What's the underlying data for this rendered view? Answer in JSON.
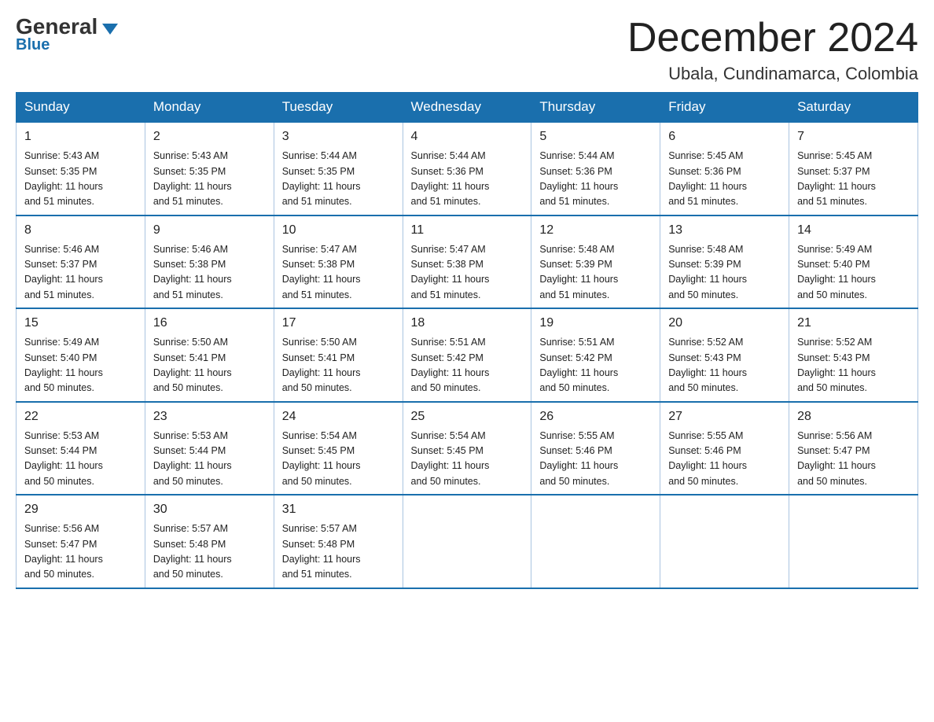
{
  "logo": {
    "text_general": "General",
    "triangle": "▶",
    "text_blue": "Blue"
  },
  "header": {
    "month": "December 2024",
    "location": "Ubala, Cundinamarca, Colombia"
  },
  "weekdays": [
    "Sunday",
    "Monday",
    "Tuesday",
    "Wednesday",
    "Thursday",
    "Friday",
    "Saturday"
  ],
  "weeks": [
    [
      {
        "day": "1",
        "sunrise": "5:43 AM",
        "sunset": "5:35 PM",
        "daylight": "11 hours and 51 minutes."
      },
      {
        "day": "2",
        "sunrise": "5:43 AM",
        "sunset": "5:35 PM",
        "daylight": "11 hours and 51 minutes."
      },
      {
        "day": "3",
        "sunrise": "5:44 AM",
        "sunset": "5:35 PM",
        "daylight": "11 hours and 51 minutes."
      },
      {
        "day": "4",
        "sunrise": "5:44 AM",
        "sunset": "5:36 PM",
        "daylight": "11 hours and 51 minutes."
      },
      {
        "day": "5",
        "sunrise": "5:44 AM",
        "sunset": "5:36 PM",
        "daylight": "11 hours and 51 minutes."
      },
      {
        "day": "6",
        "sunrise": "5:45 AM",
        "sunset": "5:36 PM",
        "daylight": "11 hours and 51 minutes."
      },
      {
        "day": "7",
        "sunrise": "5:45 AM",
        "sunset": "5:37 PM",
        "daylight": "11 hours and 51 minutes."
      }
    ],
    [
      {
        "day": "8",
        "sunrise": "5:46 AM",
        "sunset": "5:37 PM",
        "daylight": "11 hours and 51 minutes."
      },
      {
        "day": "9",
        "sunrise": "5:46 AM",
        "sunset": "5:38 PM",
        "daylight": "11 hours and 51 minutes."
      },
      {
        "day": "10",
        "sunrise": "5:47 AM",
        "sunset": "5:38 PM",
        "daylight": "11 hours and 51 minutes."
      },
      {
        "day": "11",
        "sunrise": "5:47 AM",
        "sunset": "5:38 PM",
        "daylight": "11 hours and 51 minutes."
      },
      {
        "day": "12",
        "sunrise": "5:48 AM",
        "sunset": "5:39 PM",
        "daylight": "11 hours and 51 minutes."
      },
      {
        "day": "13",
        "sunrise": "5:48 AM",
        "sunset": "5:39 PM",
        "daylight": "11 hours and 50 minutes."
      },
      {
        "day": "14",
        "sunrise": "5:49 AM",
        "sunset": "5:40 PM",
        "daylight": "11 hours and 50 minutes."
      }
    ],
    [
      {
        "day": "15",
        "sunrise": "5:49 AM",
        "sunset": "5:40 PM",
        "daylight": "11 hours and 50 minutes."
      },
      {
        "day": "16",
        "sunrise": "5:50 AM",
        "sunset": "5:41 PM",
        "daylight": "11 hours and 50 minutes."
      },
      {
        "day": "17",
        "sunrise": "5:50 AM",
        "sunset": "5:41 PM",
        "daylight": "11 hours and 50 minutes."
      },
      {
        "day": "18",
        "sunrise": "5:51 AM",
        "sunset": "5:42 PM",
        "daylight": "11 hours and 50 minutes."
      },
      {
        "day": "19",
        "sunrise": "5:51 AM",
        "sunset": "5:42 PM",
        "daylight": "11 hours and 50 minutes."
      },
      {
        "day": "20",
        "sunrise": "5:52 AM",
        "sunset": "5:43 PM",
        "daylight": "11 hours and 50 minutes."
      },
      {
        "day": "21",
        "sunrise": "5:52 AM",
        "sunset": "5:43 PM",
        "daylight": "11 hours and 50 minutes."
      }
    ],
    [
      {
        "day": "22",
        "sunrise": "5:53 AM",
        "sunset": "5:44 PM",
        "daylight": "11 hours and 50 minutes."
      },
      {
        "day": "23",
        "sunrise": "5:53 AM",
        "sunset": "5:44 PM",
        "daylight": "11 hours and 50 minutes."
      },
      {
        "day": "24",
        "sunrise": "5:54 AM",
        "sunset": "5:45 PM",
        "daylight": "11 hours and 50 minutes."
      },
      {
        "day": "25",
        "sunrise": "5:54 AM",
        "sunset": "5:45 PM",
        "daylight": "11 hours and 50 minutes."
      },
      {
        "day": "26",
        "sunrise": "5:55 AM",
        "sunset": "5:46 PM",
        "daylight": "11 hours and 50 minutes."
      },
      {
        "day": "27",
        "sunrise": "5:55 AM",
        "sunset": "5:46 PM",
        "daylight": "11 hours and 50 minutes."
      },
      {
        "day": "28",
        "sunrise": "5:56 AM",
        "sunset": "5:47 PM",
        "daylight": "11 hours and 50 minutes."
      }
    ],
    [
      {
        "day": "29",
        "sunrise": "5:56 AM",
        "sunset": "5:47 PM",
        "daylight": "11 hours and 50 minutes."
      },
      {
        "day": "30",
        "sunrise": "5:57 AM",
        "sunset": "5:48 PM",
        "daylight": "11 hours and 50 minutes."
      },
      {
        "day": "31",
        "sunrise": "5:57 AM",
        "sunset": "5:48 PM",
        "daylight": "11 hours and 51 minutes."
      },
      null,
      null,
      null,
      null
    ]
  ],
  "labels": {
    "sunrise": "Sunrise:",
    "sunset": "Sunset:",
    "daylight": "Daylight:"
  }
}
